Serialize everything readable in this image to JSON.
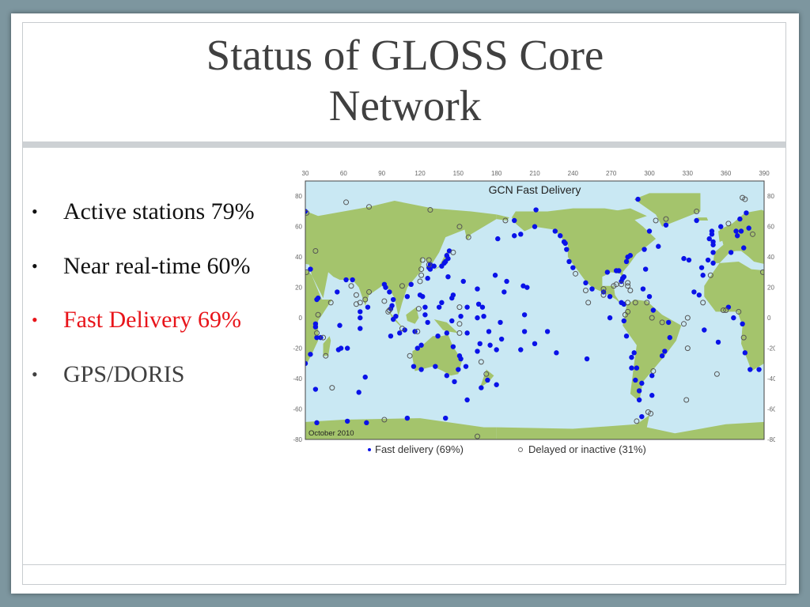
{
  "slide": {
    "title_line1": "Status of GLOSS Core",
    "title_line2": "Network",
    "bullets": [
      {
        "text": "Active stations 79%",
        "color": "#111111"
      },
      {
        "text": "Near real-time 60%",
        "color": "#111111"
      },
      {
        "text": "Fast Delivery 69%",
        "color": "#e8141a"
      },
      {
        "text": "GPS/DORIS",
        "color": "#404040"
      }
    ],
    "bullet_glyph": "•"
  },
  "colors": {
    "ocean": "#c9e8f3",
    "land": "#a4c46c",
    "fast": "#0a12e8",
    "delayed": "#555555"
  },
  "chart_data": {
    "type": "scatter",
    "title": "GCN Fast Delivery",
    "annotation": "October 2010",
    "xlim": [
      30,
      390
    ],
    "ylim": [
      -80,
      90
    ],
    "xticks": [
      30,
      60,
      90,
      120,
      150,
      180,
      210,
      240,
      270,
      300,
      330,
      360,
      390
    ],
    "yticks": [
      80,
      60,
      40,
      20,
      0,
      -20,
      -40,
      -60,
      -80
    ],
    "legend": [
      {
        "marker": "•",
        "label": "Fast delivery (69%)"
      },
      {
        "marker": "○",
        "label": "Delayed or inactive (31%)"
      }
    ],
    "series": [
      {
        "name": "Fast delivery",
        "marker": "filled",
        "points": [
          [
            30,
            70
          ],
          [
            34,
            32
          ],
          [
            34,
            -24
          ],
          [
            30,
            -30
          ],
          [
            39,
            12
          ],
          [
            40,
            13
          ],
          [
            38,
            -4
          ],
          [
            38,
            -6
          ],
          [
            39,
            -13
          ],
          [
            42,
            -13
          ],
          [
            38,
            -47
          ],
          [
            39,
            -69
          ],
          [
            55,
            17
          ],
          [
            57,
            -5
          ],
          [
            56,
            -21
          ],
          [
            58,
            -20
          ],
          [
            62,
            25
          ],
          [
            63,
            -20
          ],
          [
            67,
            25
          ],
          [
            72,
            -49
          ],
          [
            73,
            -7
          ],
          [
            73,
            0
          ],
          [
            73,
            4
          ],
          [
            77,
            -39
          ],
          [
            78,
            -69
          ],
          [
            79,
            7
          ],
          [
            63,
            -68
          ],
          [
            92,
            22
          ],
          [
            93,
            20
          ],
          [
            96,
            17
          ],
          [
            97,
            6
          ],
          [
            98,
            8
          ],
          [
            99,
            12
          ],
          [
            99,
            -1
          ],
          [
            101,
            1
          ],
          [
            97,
            -12
          ],
          [
            104,
            -10
          ],
          [
            108,
            -8
          ],
          [
            110,
            14
          ],
          [
            110,
            -66
          ],
          [
            113,
            22
          ],
          [
            116,
            -9
          ],
          [
            118,
            -20
          ],
          [
            120,
            15
          ],
          [
            121,
            -18
          ],
          [
            122,
            14
          ],
          [
            121,
            -34
          ],
          [
            115,
            -32
          ],
          [
            124,
            7
          ],
          [
            124,
            2
          ],
          [
            126,
            26
          ],
          [
            126,
            -3
          ],
          [
            127,
            33
          ],
          [
            128,
            32
          ],
          [
            128,
            35
          ],
          [
            131,
            34
          ],
          [
            134,
            -12
          ],
          [
            132,
            -32
          ],
          [
            135,
            7
          ],
          [
            137,
            10
          ],
          [
            137,
            34
          ],
          [
            139,
            36
          ],
          [
            140,
            37
          ],
          [
            141,
            41
          ],
          [
            142,
            39
          ],
          [
            143,
            44
          ],
          [
            142,
            27
          ],
          [
            141,
            -10
          ],
          [
            141,
            -38
          ],
          [
            140,
            -66
          ],
          [
            145,
            13
          ],
          [
            146,
            15
          ],
          [
            145,
            -2
          ],
          [
            146,
            -19
          ],
          [
            147,
            -42
          ],
          [
            150,
            -34
          ],
          [
            151,
            -25
          ],
          [
            152,
            -27
          ],
          [
            154,
            24
          ],
          [
            152,
            1
          ],
          [
            157,
            -10
          ],
          [
            157,
            7
          ],
          [
            156,
            -32
          ],
          [
            157,
            -54
          ],
          [
            165,
            19
          ],
          [
            165,
            0
          ],
          [
            166,
            9
          ],
          [
            167,
            -17
          ],
          [
            165,
            -22
          ],
          [
            168,
            -46
          ],
          [
            169,
            7
          ],
          [
            170,
            1
          ],
          [
            173,
            -41
          ],
          [
            174,
            -9
          ],
          [
            175,
            -18
          ],
          [
            179,
            28
          ],
          [
            181,
            52
          ],
          [
            180,
            -44
          ],
          [
            180,
            -21
          ],
          [
            183,
            -3
          ],
          [
            184,
            -14
          ],
          [
            186,
            17
          ],
          [
            188,
            24
          ],
          [
            194,
            54
          ],
          [
            194,
            64
          ],
          [
            199,
            55
          ],
          [
            199,
            -21
          ],
          [
            201,
            21
          ],
          [
            202,
            2
          ],
          [
            202,
            -9
          ],
          [
            204,
            20
          ],
          [
            210,
            60
          ],
          [
            211,
            71
          ],
          [
            210,
            -17
          ],
          [
            220,
            -9
          ],
          [
            226,
            57
          ],
          [
            227,
            -23
          ],
          [
            230,
            54
          ],
          [
            233,
            50
          ],
          [
            234,
            49
          ],
          [
            235,
            45
          ],
          [
            237,
            37
          ],
          [
            240,
            33
          ],
          [
            250,
            23
          ],
          [
            251,
            -27
          ],
          [
            255,
            19
          ],
          [
            264,
            17
          ],
          [
            267,
            30
          ],
          [
            269,
            14
          ],
          [
            269,
            0
          ],
          [
            274,
            31
          ],
          [
            276,
            31
          ],
          [
            278,
            24
          ],
          [
            279,
            26
          ],
          [
            280,
            27
          ],
          [
            278,
            10
          ],
          [
            280,
            9
          ],
          [
            280,
            -2
          ],
          [
            282,
            -12
          ],
          [
            282,
            37
          ],
          [
            283,
            40
          ],
          [
            285,
            41
          ],
          [
            286,
            -26
          ],
          [
            286,
            -33
          ],
          [
            288,
            -23
          ],
          [
            289,
            -41
          ],
          [
            290,
            -33
          ],
          [
            292,
            -48
          ],
          [
            292,
            -54
          ],
          [
            291,
            78
          ],
          [
            294,
            -43
          ],
          [
            295,
            19
          ],
          [
            296,
            45
          ],
          [
            297,
            32
          ],
          [
            294,
            -65
          ],
          [
            300,
            57
          ],
          [
            300,
            14
          ],
          [
            303,
            5
          ],
          [
            302,
            -38
          ],
          [
            302,
            -51
          ],
          [
            307,
            47
          ],
          [
            310,
            -25
          ],
          [
            312,
            -22
          ],
          [
            313,
            61
          ],
          [
            315,
            -3
          ],
          [
            316,
            -13
          ],
          [
            327,
            39
          ],
          [
            331,
            38
          ],
          [
            335,
            17
          ],
          [
            337,
            64
          ],
          [
            339,
            15
          ],
          [
            341,
            33
          ],
          [
            342,
            28
          ],
          [
            343,
            -8
          ],
          [
            346,
            38
          ],
          [
            347,
            52
          ],
          [
            349,
            57
          ],
          [
            349,
            55
          ],
          [
            350,
            50
          ],
          [
            350,
            48
          ],
          [
            350,
            43
          ],
          [
            350,
            36
          ],
          [
            354,
            -16
          ],
          [
            356,
            60
          ],
          [
            362,
            7
          ],
          [
            364,
            43
          ],
          [
            366,
            0
          ],
          [
            368,
            57
          ],
          [
            369,
            54
          ],
          [
            371,
            65
          ],
          [
            372,
            57
          ],
          [
            373,
            -4
          ],
          [
            374,
            46
          ],
          [
            375,
            -23
          ],
          [
            376,
            69
          ],
          [
            378,
            59
          ],
          [
            379,
            -34
          ],
          [
            386,
            -34
          ]
        ]
      },
      {
        "name": "Delayed or inactive",
        "marker": "open",
        "points": [
          [
            31,
            69
          ],
          [
            31,
            30
          ],
          [
            62,
            76
          ],
          [
            80,
            73
          ],
          [
            38,
            44
          ],
          [
            39,
            -10
          ],
          [
            44,
            -13
          ],
          [
            46,
            -25
          ],
          [
            40,
            2
          ],
          [
            50,
            10
          ],
          [
            51,
            -46
          ],
          [
            66,
            21
          ],
          [
            70,
            15
          ],
          [
            70,
            9
          ],
          [
            73,
            10
          ],
          [
            77,
            12
          ],
          [
            80,
            17
          ],
          [
            92,
            11
          ],
          [
            95,
            4
          ],
          [
            96,
            5
          ],
          [
            106,
            -7
          ],
          [
            106,
            21
          ],
          [
            112,
            -25
          ],
          [
            118,
            -9
          ],
          [
            119,
            6
          ],
          [
            120,
            24
          ],
          [
            121,
            28
          ],
          [
            121,
            32
          ],
          [
            122,
            38
          ],
          [
            127,
            38
          ],
          [
            127,
            35
          ],
          [
            128,
            71
          ],
          [
            146,
            43
          ],
          [
            151,
            60
          ],
          [
            151,
            7
          ],
          [
            151,
            -4
          ],
          [
            151,
            -10
          ],
          [
            158,
            53
          ],
          [
            168,
            -29
          ],
          [
            172,
            -37
          ],
          [
            165,
            -78
          ],
          [
            187,
            64
          ],
          [
            92,
            -67
          ],
          [
            242,
            29
          ],
          [
            250,
            18
          ],
          [
            252,
            10
          ],
          [
            264,
            19
          ],
          [
            264,
            15
          ],
          [
            272,
            21
          ],
          [
            274,
            22
          ],
          [
            278,
            22
          ],
          [
            283,
            21
          ],
          [
            283,
            23
          ],
          [
            285,
            18
          ],
          [
            283,
            10
          ],
          [
            283,
            4
          ],
          [
            281,
            2
          ],
          [
            289,
            10
          ],
          [
            298,
            10
          ],
          [
            302,
            0
          ],
          [
            303,
            -35
          ],
          [
            299,
            -62
          ],
          [
            301,
            -63
          ],
          [
            290,
            -68
          ],
          [
            305,
            64
          ],
          [
            310,
            -3
          ],
          [
            313,
            65
          ],
          [
            330,
            0
          ],
          [
            327,
            -4
          ],
          [
            330,
            -20
          ],
          [
            329,
            -54
          ],
          [
            337,
            70
          ],
          [
            348,
            28
          ],
          [
            353,
            -37
          ],
          [
            358,
            5
          ],
          [
            360,
            5
          ],
          [
            362,
            62
          ],
          [
            370,
            4
          ],
          [
            374,
            -13
          ],
          [
            373,
            79
          ],
          [
            375,
            78
          ],
          [
            381,
            55
          ],
          [
            389,
            30
          ],
          [
            342,
            10
          ]
        ]
      }
    ]
  }
}
